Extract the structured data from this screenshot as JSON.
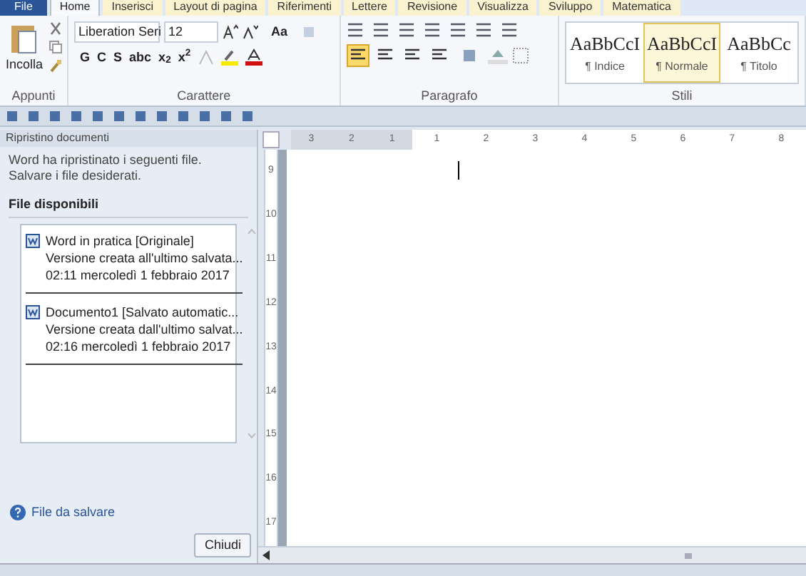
{
  "file_tab": "File",
  "tabs": [
    {
      "label": "Home",
      "selected": true
    },
    {
      "label": "Inserisci",
      "selected": false
    },
    {
      "label": "Layout di pagina",
      "selected": false
    },
    {
      "label": "Riferimenti",
      "selected": false
    },
    {
      "label": "Lettere",
      "selected": false
    },
    {
      "label": "Revisione",
      "selected": false
    },
    {
      "label": "Visualizza",
      "selected": false
    },
    {
      "label": "Sviluppo",
      "selected": false
    },
    {
      "label": "Matematica",
      "selected": false
    }
  ],
  "clipboard": {
    "label": "Appunti",
    "paste_label": "Incolla"
  },
  "font": {
    "label": "Carattere",
    "font_name": "Liberation Seri",
    "font_size": "12",
    "change_case": "Aa",
    "format_buttons": [
      "G",
      "C",
      "S",
      "abc",
      "x$_{2}$",
      "x$^{2}$"
    ]
  },
  "paragraph": {
    "label": "Paragrafo",
    "alignments": [
      {
        "selected": true
      },
      {
        "selected": false
      },
      {
        "selected": false
      },
      {
        "selected": false
      }
    ]
  },
  "styles": {
    "label": "Stili",
    "items": [
      {
        "sample": "AaBbCcI",
        "name": "¶ Indice",
        "selected": false
      },
      {
        "sample": "AaBbCcI",
        "name": "¶ Normale",
        "selected": true
      },
      {
        "sample": "AaBbCc",
        "name": "¶ Titolo",
        "selected": false
      }
    ]
  },
  "recovery_pane": {
    "title": "Ripristino documenti",
    "message": "Word ha ripristinato i seguenti file. Salvare i file desiderati.",
    "section": "File disponibili",
    "files": [
      {
        "name": "Word in pratica  [Originale]",
        "detail": "Versione creata all'ultimo salvata...",
        "time": "02:11 mercoledì 1 febbraio 2017"
      },
      {
        "name": "Documento1  [Salvato automatic...",
        "detail": "Versione creata dall'ultimo salvat...",
        "time": "02:16 mercoledì 1 febbraio 2017"
      }
    ],
    "help_link": "File da salvare",
    "close_button": "Chiudi"
  },
  "ruler": {
    "horizontal": [
      "3",
      "2",
      "1",
      "1",
      "2",
      "3",
      "4",
      "5",
      "6",
      "7",
      "8"
    ],
    "vertical": [
      "9",
      "10",
      "11",
      "12",
      "13",
      "14",
      "15",
      "16",
      "17"
    ]
  }
}
